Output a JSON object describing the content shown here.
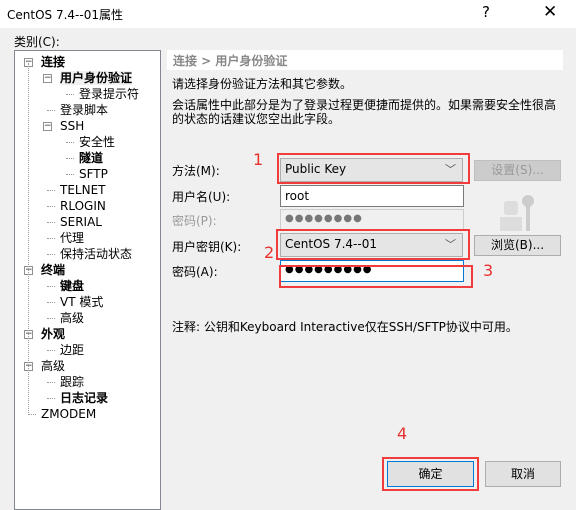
{
  "window": {
    "title": "CentOS 7.4--01属性",
    "help": "?",
    "close": "✕"
  },
  "category_label": "类别(C):",
  "tree": [
    {
      "label": "连接",
      "bold": true,
      "level": 0,
      "expand": "−"
    },
    {
      "label": "用户身份验证",
      "bold": true,
      "level": 1,
      "expand": "−",
      "selected": true
    },
    {
      "label": "登录提示符",
      "level": 2
    },
    {
      "label": "登录脚本",
      "level": 1
    },
    {
      "label": "SSH",
      "level": 1,
      "expand": "−"
    },
    {
      "label": "安全性",
      "level": 2
    },
    {
      "label": "隧道",
      "bold": true,
      "level": 2
    },
    {
      "label": "SFTP",
      "level": 2
    },
    {
      "label": "TELNET",
      "level": 1
    },
    {
      "label": "RLOGIN",
      "level": 1
    },
    {
      "label": "SERIAL",
      "level": 1
    },
    {
      "label": "代理",
      "level": 1
    },
    {
      "label": "保持活动状态",
      "level": 1
    },
    {
      "label": "终端",
      "bold": true,
      "level": 0,
      "expand": "−"
    },
    {
      "label": "键盘",
      "bold": true,
      "level": 1
    },
    {
      "label": "VT 模式",
      "level": 1
    },
    {
      "label": "高级",
      "level": 1
    },
    {
      "label": "外观",
      "bold": true,
      "level": 0,
      "expand": "−"
    },
    {
      "label": "边距",
      "level": 1
    },
    {
      "label": "高级",
      "level": 0,
      "expand": "−"
    },
    {
      "label": "跟踪",
      "level": 1
    },
    {
      "label": "日志记录",
      "bold": true,
      "level": 1
    },
    {
      "label": "ZMODEM",
      "level": 0
    }
  ],
  "panel": {
    "header": "连接 > 用户身份验证",
    "desc1": "请选择身份验证方法和其它参数。",
    "desc2": "会话属性中此部分是为了登录过程更便捷而提供的。如果需要安全性很高",
    "desc3": "的状态的话建议您空出此字段。",
    "method_label": "方法(M):",
    "method_value": "Public Key",
    "settings_button": "设置(S)...",
    "username_label": "用户名(U):",
    "username_value": "root",
    "password_label": "密码(P):",
    "password_value": "●●●●●●●●",
    "userkey_label": "用户密钥(K):",
    "userkey_value": "CentOS 7.4--01",
    "browse_button": "浏览(B)...",
    "passphrase_label": "密码(A):",
    "passphrase_value": "●●●●●●●●●",
    "note": "注释: 公钥和Keyboard Interactive仅在SSH/SFTP协议中可用。"
  },
  "annotations": [
    "1",
    "2",
    "3",
    "4"
  ],
  "buttons": {
    "ok": "确定",
    "cancel": "取消"
  },
  "colors": {
    "annotation": "#f03c3c",
    "focus": "#0078d7"
  }
}
